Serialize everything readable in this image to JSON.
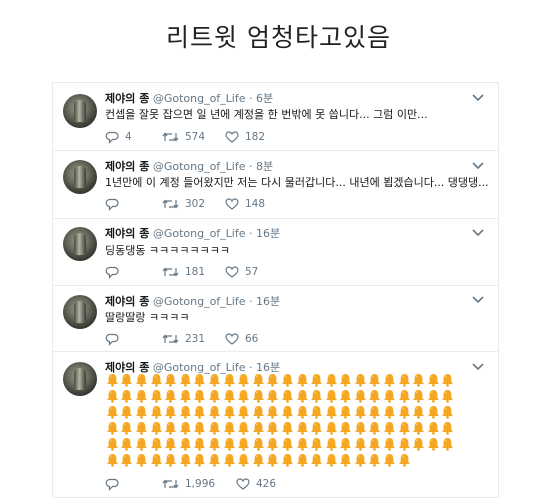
{
  "headline": "리트윗 엄청타고있음",
  "tweets": [
    {
      "name": "제야의 종",
      "handle": "@Gotong_of_Life",
      "time": "· 6분",
      "text": "컨셉을 잘못 잡으면 일 년에 계정을 한 번밖에 못 씁니다... 그럼 이만...",
      "replies": "4",
      "retweets": "574",
      "likes": "182"
    },
    {
      "name": "제야의 종",
      "handle": "@Gotong_of_Life",
      "time": "· 8분",
      "text": "1년만에 이 계정 들어왔지만 저는 다시 물러갑니다... 내년에 뵙겠습니다... 댕댕댕...",
      "replies": "",
      "retweets": "302",
      "likes": "148"
    },
    {
      "name": "제야의 종",
      "handle": "@Gotong_of_Life",
      "time": "· 16분",
      "text": "딩동댕동 ㅋㅋㅋㅋㅋㅋㅋㅋ",
      "replies": "",
      "retweets": "181",
      "likes": "57"
    },
    {
      "name": "제야의 종",
      "handle": "@Gotong_of_Life",
      "time": "· 16분",
      "text": "딸랑딸랑 ㅋㅋㅋㅋ",
      "replies": "",
      "retweets": "231",
      "likes": "66"
    },
    {
      "name": "제야의 종",
      "handle": "@Gotong_of_Life",
      "time": "· 16분",
      "bell_rows": [
        24,
        24,
        24,
        24,
        24,
        21
      ],
      "bell_color": "#f5a623",
      "replies": "",
      "retweets": "1,996",
      "likes": "426"
    }
  ],
  "colors": {
    "text": "#14171a",
    "muted": "#657786",
    "border": "#e6ecf0",
    "bell": "#f5a623"
  },
  "icons": {
    "reply": "reply-icon",
    "retweet": "retweet-icon",
    "like": "heart-icon",
    "menu": "chevron-down-icon",
    "bell": "bell-icon"
  }
}
